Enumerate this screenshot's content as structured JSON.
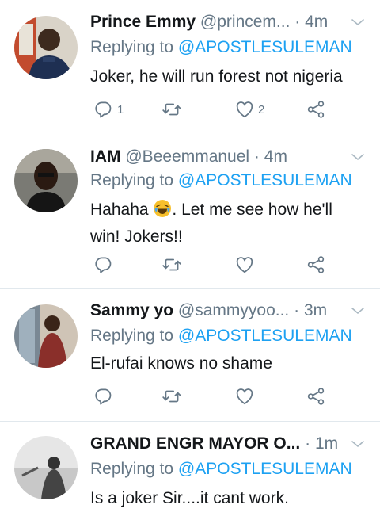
{
  "colors": {
    "link": "#1da1f2",
    "secondary": "#657786",
    "text": "#14171a",
    "divider": "#e1e8ed"
  },
  "replying_prefix": "Replying to",
  "tweets": [
    {
      "name": "Prince Emmy",
      "handle": "@princem...",
      "separator": "·",
      "time": "4m",
      "mention": "@APOSTLESULEMAN",
      "text": "Joker, he will run forest not nigeria",
      "reply_count": "1",
      "retweet_count": "",
      "like_count": "2"
    },
    {
      "name": "IAM",
      "handle": "@Beeemmanuel",
      "separator": "·",
      "time": "4m",
      "mention": "@APOSTLESULEMAN",
      "text_before_emoji": "Hahaha ",
      "emoji": "face-with-tears-of-joy",
      "text_after_emoji": ". Let me see how he'll win! Jokers!!",
      "reply_count": "",
      "retweet_count": "",
      "like_count": ""
    },
    {
      "name": "Sammy yo",
      "handle": "@sammyyoo...",
      "separator": "·",
      "time": "3m",
      "mention": "@APOSTLESULEMAN",
      "text": "El-rufai knows no shame",
      "reply_count": "",
      "retweet_count": "",
      "like_count": ""
    },
    {
      "name": "GRAND ENGR MAYOR O...",
      "handle": "",
      "separator": "·",
      "time": "1m",
      "mention": "@APOSTLESULEMAN",
      "text": "Is a joker Sir....it cant work."
    }
  ],
  "icons": [
    "reply-icon",
    "retweet-icon",
    "like-icon",
    "share-icon",
    "chevron-down-icon"
  ]
}
